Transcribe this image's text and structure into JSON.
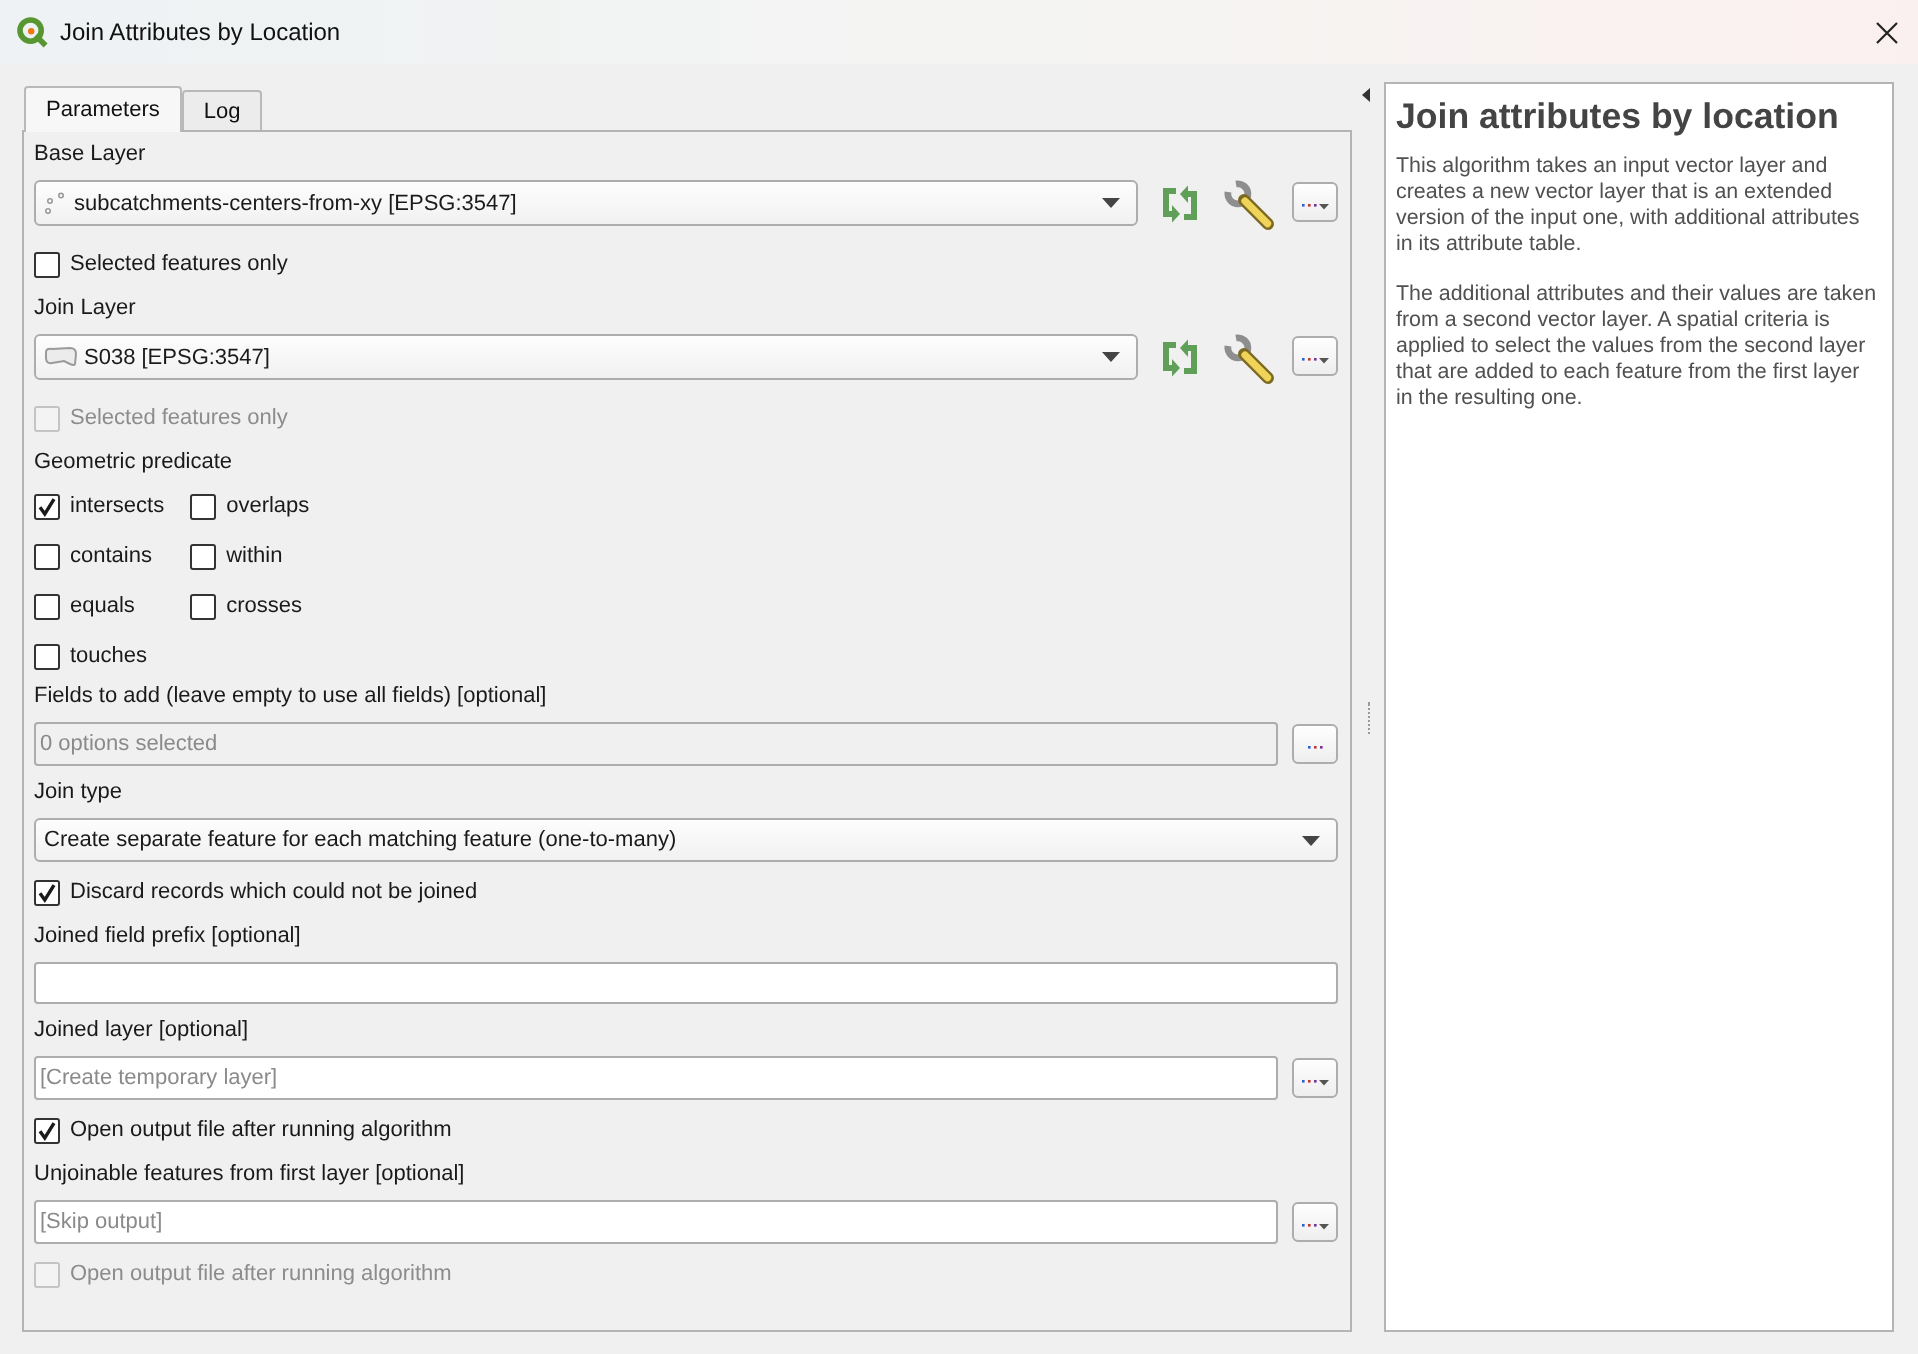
{
  "window": {
    "title": "Join Attributes by Location"
  },
  "tabs": [
    {
      "label": "Parameters",
      "selected": true
    },
    {
      "label": "Log",
      "selected": false
    }
  ],
  "parameters": [
    {
      "kind": "heading",
      "text": "Base Layer"
    },
    {
      "kind": "pointlayer",
      "value": "subcatchments-centers-from-xy [EPSG:3547]"
    },
    {
      "kind": "checkbox",
      "label": "Selected features only",
      "checked": false,
      "disabled": false
    },
    {
      "kind": "heading",
      "text": "Join Layer"
    },
    {
      "kind": "polygonlayer",
      "value": "S038 [EPSG:3547]"
    },
    {
      "kind": "checkbox",
      "label": "Selected features only",
      "checked": false,
      "disabled": true
    },
    {
      "kind": "heading",
      "text": "Geometric predicate"
    },
    {
      "kind": "checkgrid",
      "options": [
        {
          "label": "intersects",
          "checked": true
        },
        {
          "label": "overlaps",
          "checked": false
        },
        {
          "label": "contains",
          "checked": false
        },
        {
          "label": "within",
          "checked": false
        },
        {
          "label": "equals",
          "checked": false
        },
        {
          "label": "crosses",
          "checked": false
        },
        {
          "label": "touches",
          "checked": false
        }
      ]
    },
    {
      "kind": "heading",
      "text": "Fields to add (leave empty to use all fields) [optional]"
    },
    {
      "kind": "multiselect",
      "value": "0 options selected",
      "disabled": true
    },
    {
      "kind": "heading",
      "text": "Join type"
    },
    {
      "kind": "combo",
      "value": "Create separate feature for each matching feature (one-to-many)"
    },
    {
      "kind": "checkbox",
      "label": "Discard records which could not be joined",
      "checked": true,
      "disabled": false
    },
    {
      "kind": "heading",
      "text": "Joined field prefix [optional]"
    },
    {
      "kind": "text"
    },
    {
      "kind": "heading",
      "text": "Joined layer [optional]"
    },
    {
      "kind": "output",
      "placeholder": "[Create temporary layer]"
    },
    {
      "kind": "checkbox",
      "label": "Open output file after running algorithm",
      "checked": true,
      "disabled": false
    },
    {
      "kind": "heading",
      "text": "Unjoinable features from first layer [optional]"
    },
    {
      "kind": "output",
      "placeholder": "[Skip output]"
    },
    {
      "kind": "checkbox",
      "label": "Open output file after running algorithm",
      "checked": false,
      "disabled": true
    }
  ],
  "help": {
    "title": "Join attributes by location",
    "paragraphs": [
      "This algorithm takes an input vector layer and creates a new vector layer that is an extended version of the input one, with additional attributes in its attribute table.",
      "The additional attributes and their values are taken from a second vector layer. A spatial criteria is applied to select the values from the second layer that are added to each feature from the first layer in the resulting one."
    ]
  }
}
